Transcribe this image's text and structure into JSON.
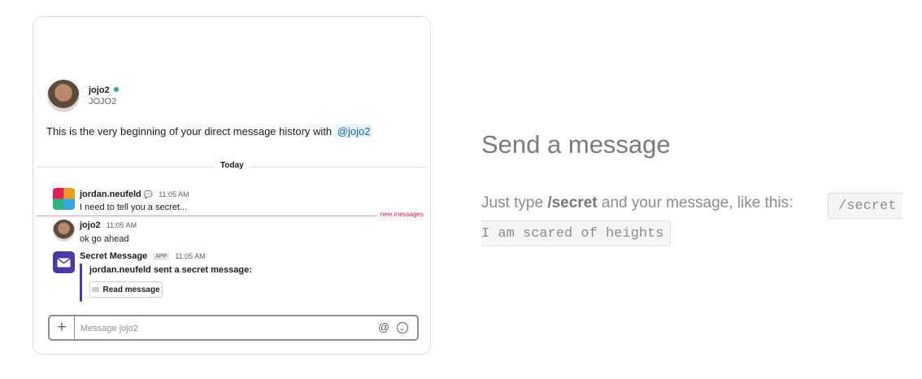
{
  "dm": {
    "user_name": "jojo2",
    "user_handle": "JOJO2",
    "history_intro": "This is the very beginning of your direct message history with",
    "mention": "@jojo2",
    "day_divider": "Today",
    "new_messages_label": "new messages"
  },
  "messages": [
    {
      "author": "jordan.neufeld",
      "time": "11:05 AM",
      "text": "I need to tell you a secret..."
    },
    {
      "author": "jojo2",
      "time": "11:05 AM",
      "text": "ok go ahead"
    },
    {
      "author": "Secret Message",
      "badge": "APP",
      "time": "11:05 AM",
      "attachment_title": "jordan.neufeld sent a secret message:",
      "button_label": "Read message"
    }
  ],
  "composer": {
    "placeholder": "Message jojo2"
  },
  "instructions": {
    "title": "Send a message",
    "text_before": "Just type",
    "command": "/secret",
    "text_after": "and your message, like this:",
    "example_line1": "/secret",
    "example_line2": "I am scared of heights"
  },
  "colors": {
    "presence": "#2bac76",
    "app_accent": "#4a3aa8",
    "new_messages": "#e01e5a",
    "mention": "#1264a3"
  },
  "icons": [
    "user-avatar",
    "slack-app-avatar",
    "envelope-icon",
    "plus-icon",
    "at-icon",
    "emoji-icon",
    "chat-bubble-icon"
  ]
}
